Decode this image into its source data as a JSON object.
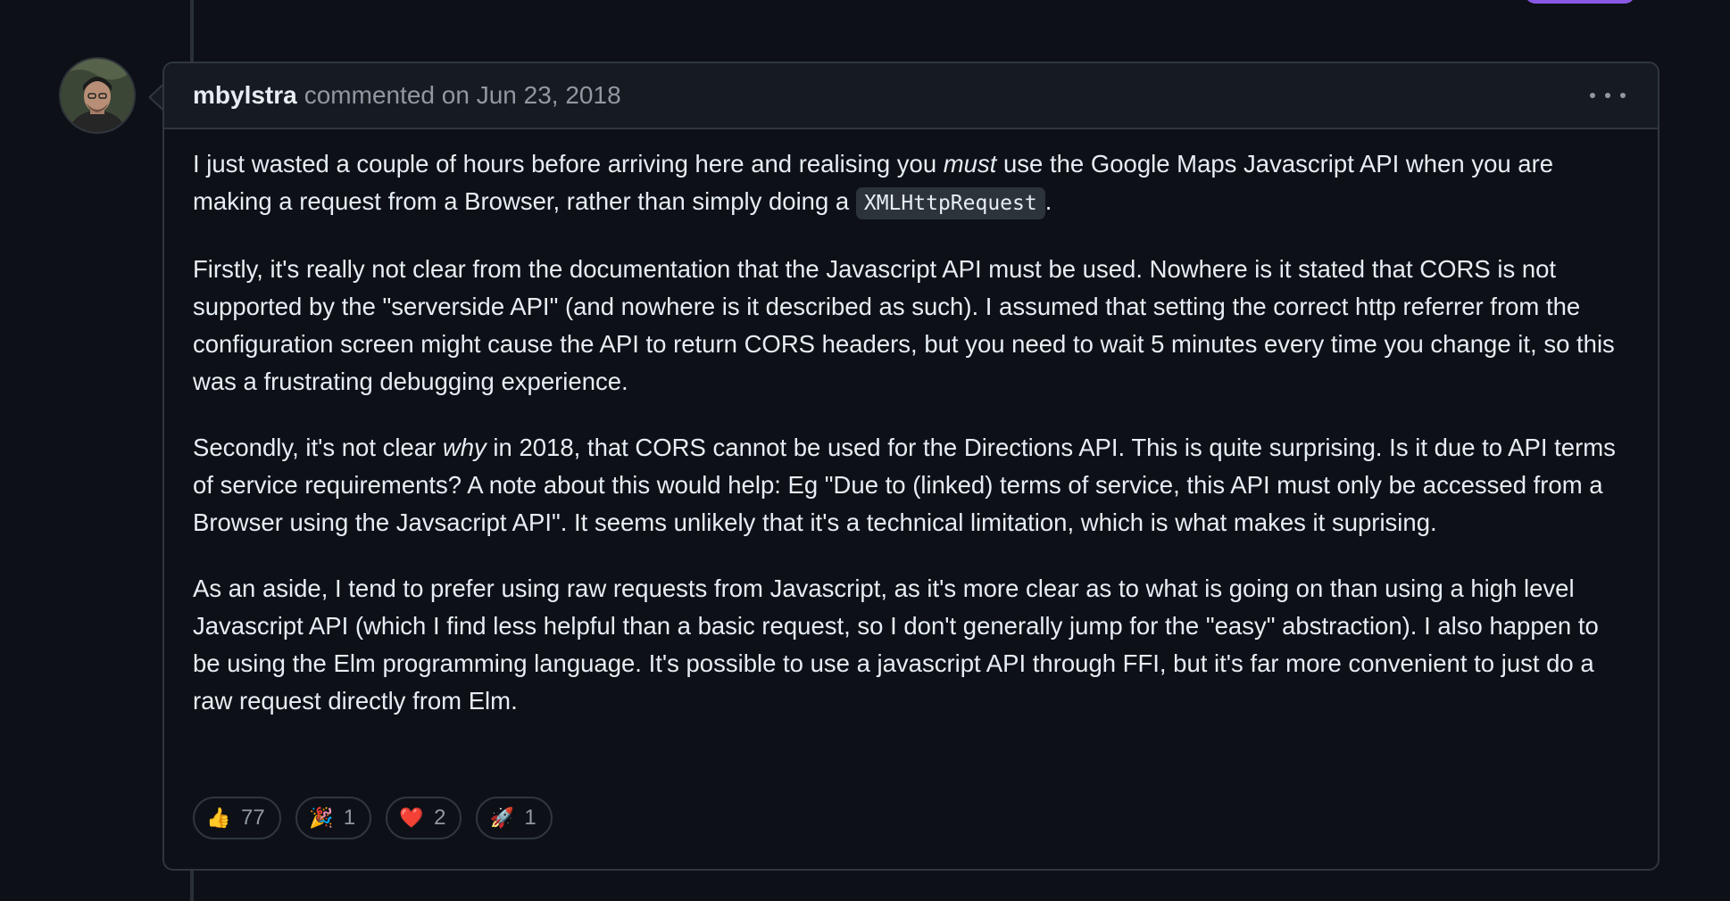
{
  "comment": {
    "author": "mbylstra",
    "action": "commented on",
    "date": "Jun 23, 2018",
    "paragraphs": {
      "p1": {
        "a": "I just wasted a couple of hours before arriving here and realising you ",
        "b": "must",
        "c": " use the Google Maps Javascript API when you are making a request from a Browser, rather than simply doing a ",
        "code": "XMLHttpRequest",
        "d": "."
      },
      "p2": "Firstly, it's really not clear from the documentation that the Javascript API must be used. Nowhere is it stated that CORS is not supported by the \"serverside API\" (and nowhere is it described as such). I assumed that setting the correct http referrer from the configuration screen might cause the API to return CORS headers, but you need to wait 5 minutes every time you change it, so this was a frustrating debugging experience.",
      "p3": {
        "a": "Secondly, it's not clear ",
        "b": "why",
        "c": " in 2018, that CORS cannot be used for the Directions API. This is quite surprising. Is it due to API terms of service requirements? A note about this would help: Eg \"Due to (linked) terms of service, this API must only be accessed from a Browser using the Javsacript API\". It seems unlikely that it's a technical limitation, which is what makes it suprising."
      },
      "p4": "As an aside, I tend to prefer using raw requests from Javascript, as it's more clear as to what is going on than using a high level Javascript API (which I find less helpful than a basic request, so I don't generally jump for the \"easy\" abstraction). I also happen to be using the Elm programming language. It's possible to use a javascript API through FFI, but it's far more convenient to just do a raw request directly from Elm."
    },
    "reactions": [
      {
        "icon": "thumbs-up",
        "emoji": "👍",
        "count": "77"
      },
      {
        "icon": "party-popper",
        "emoji": "🎉",
        "count": "1"
      },
      {
        "icon": "heart",
        "emoji": "❤️",
        "count": "2"
      },
      {
        "icon": "rocket",
        "emoji": "🚀",
        "count": "1"
      }
    ]
  },
  "colors": {
    "background": "#0d1117",
    "header": "#161b22",
    "border": "#30363d",
    "text": "#e6edf3",
    "muted": "#9198a1",
    "accent": "#8957e5"
  }
}
